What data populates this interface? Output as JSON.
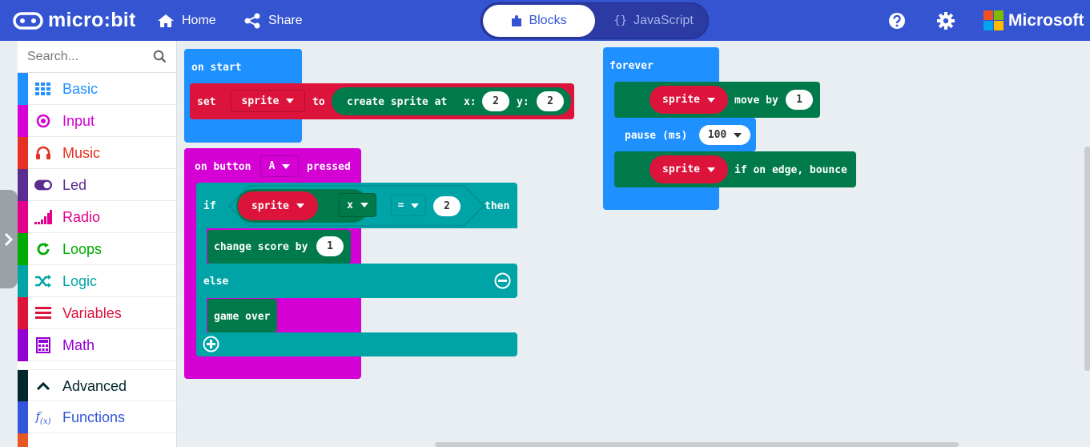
{
  "header": {
    "logo_text": "micro:bit",
    "home_label": "Home",
    "share_label": "Share",
    "tab_blocks": "Blocks",
    "tab_javascript": "JavaScript",
    "tab_js_glyph": "{}",
    "brand": "Microsoft",
    "color": "#3454d1"
  },
  "sidebar": {
    "search_placeholder": "Search...",
    "categories": [
      {
        "label": "Basic",
        "color": "#1e90ff",
        "icon": "grid-icon"
      },
      {
        "label": "Input",
        "color": "#d400d4",
        "icon": "target-icon"
      },
      {
        "label": "Music",
        "color": "#e63022",
        "icon": "headphones-icon"
      },
      {
        "label": "Led",
        "color": "#5c2d91",
        "icon": "toggle-icon"
      },
      {
        "label": "Radio",
        "color": "#e3008c",
        "icon": "signal-bars-icon"
      },
      {
        "label": "Loops",
        "color": "#00aa00",
        "icon": "refresh-icon"
      },
      {
        "label": "Logic",
        "color": "#00a4a6",
        "icon": "shuffle-icon"
      },
      {
        "label": "Variables",
        "color": "#dc143c",
        "icon": "list-icon"
      },
      {
        "label": "Math",
        "color": "#9400d3",
        "icon": "calculator-icon"
      },
      {
        "label": "Advanced",
        "color": "#00272b",
        "icon": "chevron-up-icon"
      },
      {
        "label": "Functions",
        "color": "#3455db",
        "icon": "function-icon"
      }
    ]
  },
  "blocks": {
    "on_start": {
      "label": "on start",
      "set_label": "set",
      "var_name": "sprite",
      "to_label": "to",
      "create_label": "create sprite at",
      "x_label": "x:",
      "x_value": "2",
      "y_label": "y:",
      "y_value": "2"
    },
    "on_button": {
      "label_prefix": "on button",
      "button": "A",
      "label_suffix": "pressed",
      "if_label": "if",
      "cond_var": "sprite",
      "cond_prop": "x",
      "cond_op": "=",
      "cond_value": "2",
      "then_label": "then",
      "change_label": "change score by",
      "change_value": "1",
      "else_label": "else",
      "game_over_label": "game over"
    },
    "forever": {
      "label": "forever",
      "move_var": "sprite",
      "move_label": "move by",
      "move_value": "1",
      "pause_label": "pause (ms)",
      "pause_value": "100",
      "bounce_var": "sprite",
      "bounce_label": "if on edge, bounce"
    }
  },
  "colors": {
    "basic": "#1e90ff",
    "input": "#d400d4",
    "logic": "#00a4a6",
    "variables": "#dc143c",
    "game": "#007a4b"
  }
}
